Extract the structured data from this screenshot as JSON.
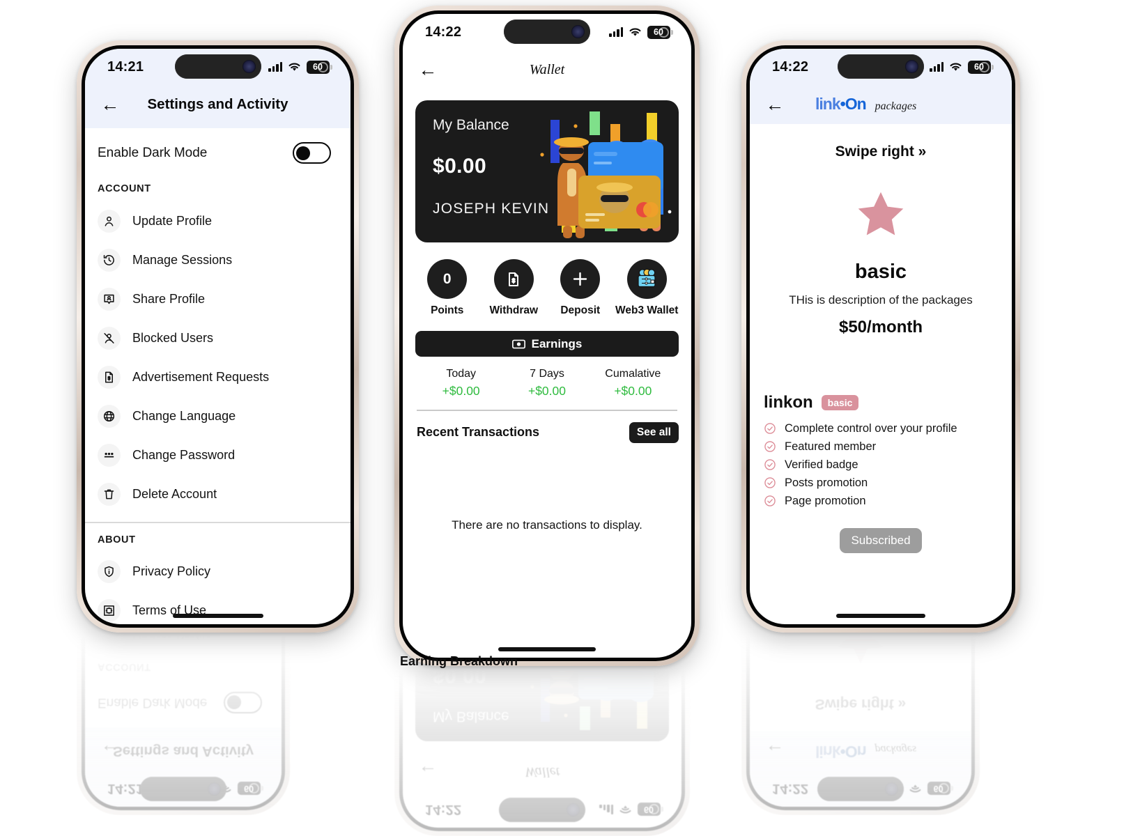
{
  "phone1": {
    "status": {
      "time": "14:21",
      "battery": "60",
      "signal_icon": "cellular-bars-icon",
      "wifi_icon": "wifi-icon",
      "battery_icon": "battery-icon"
    },
    "appbar": {
      "back_icon": "back-arrow-icon",
      "title": "Settings and Activity"
    },
    "dark_mode": {
      "label": "Enable Dark Mode",
      "state": "off"
    },
    "sections": [
      {
        "heading": "ACCOUNT",
        "items": [
          {
            "label": "Update Profile",
            "icon": "user-icon"
          },
          {
            "label": "Manage Sessions",
            "icon": "history-clock-icon"
          },
          {
            "label": "Share Profile",
            "icon": "contact-card-icon"
          },
          {
            "label": "Blocked Users",
            "icon": "user-blocked-icon"
          },
          {
            "label": "Advertisement Requests",
            "icon": "document-dollar-icon"
          },
          {
            "label": "Change Language",
            "icon": "globe-icon"
          },
          {
            "label": "Change Password",
            "icon": "password-dots-icon"
          },
          {
            "label": "Delete Account",
            "icon": "trash-icon"
          }
        ]
      },
      {
        "heading": "ABOUT",
        "items": [
          {
            "label": "Privacy Policy",
            "icon": "shield-info-icon"
          },
          {
            "label": "Terms of Use",
            "icon": "terms-puzzle-icon"
          }
        ]
      }
    ]
  },
  "phone2": {
    "status": {
      "time": "14:22",
      "battery": "60"
    },
    "appbar": {
      "back_icon": "back-arrow-icon",
      "title": "Wallet"
    },
    "balance_card": {
      "label": "My Balance",
      "amount": "$0.00",
      "holder": "JOSEPH  KEVIN",
      "art": "credit-card-characters-illustration"
    },
    "actions": [
      {
        "label": "Points",
        "value": "0",
        "icon": "points-zero-icon"
      },
      {
        "label": "Withdraw",
        "icon": "document-dollar-icon"
      },
      {
        "label": "Deposit",
        "icon": "plus-icon"
      },
      {
        "label": "Web3 Wallet",
        "icon": "web3-wallet-icon"
      }
    ],
    "earnings": {
      "button_label": "Earnings",
      "button_icon": "banknote-icon",
      "columns": [
        {
          "key": "Today",
          "value": "+$0.00"
        },
        {
          "key": "7 Days",
          "value": "+$0.00"
        },
        {
          "key": "Cumalative",
          "value": "+$0.00"
        }
      ]
    },
    "transactions": {
      "title": "Recent Transactions",
      "see_all": "See all",
      "empty": "There are no transactions to display."
    },
    "breakdown_title": "Earning Breakdown"
  },
  "phone3": {
    "status": {
      "time": "14:22",
      "battery": "60"
    },
    "appbar": {
      "back_icon": "back-arrow-icon",
      "logo_part1": "link",
      "logo_part2": "On",
      "subtitle": "packages"
    },
    "swipe_hint": "Swipe right »",
    "package": {
      "icon": "star-icon",
      "star_color": "#d9939e",
      "name": "basic",
      "description": "THis is description of the packages",
      "price": "$50/month"
    },
    "features": {
      "brand": "linkon",
      "badge": "basic",
      "badge_color": "#d9929d",
      "items": [
        "Complete control over your profile",
        "Featured member",
        "Verified badge",
        "Posts promotion",
        "Page promotion"
      ],
      "check_icon": "check-circle-icon"
    },
    "cta": {
      "label": "Subscribed",
      "state": "disabled"
    }
  }
}
